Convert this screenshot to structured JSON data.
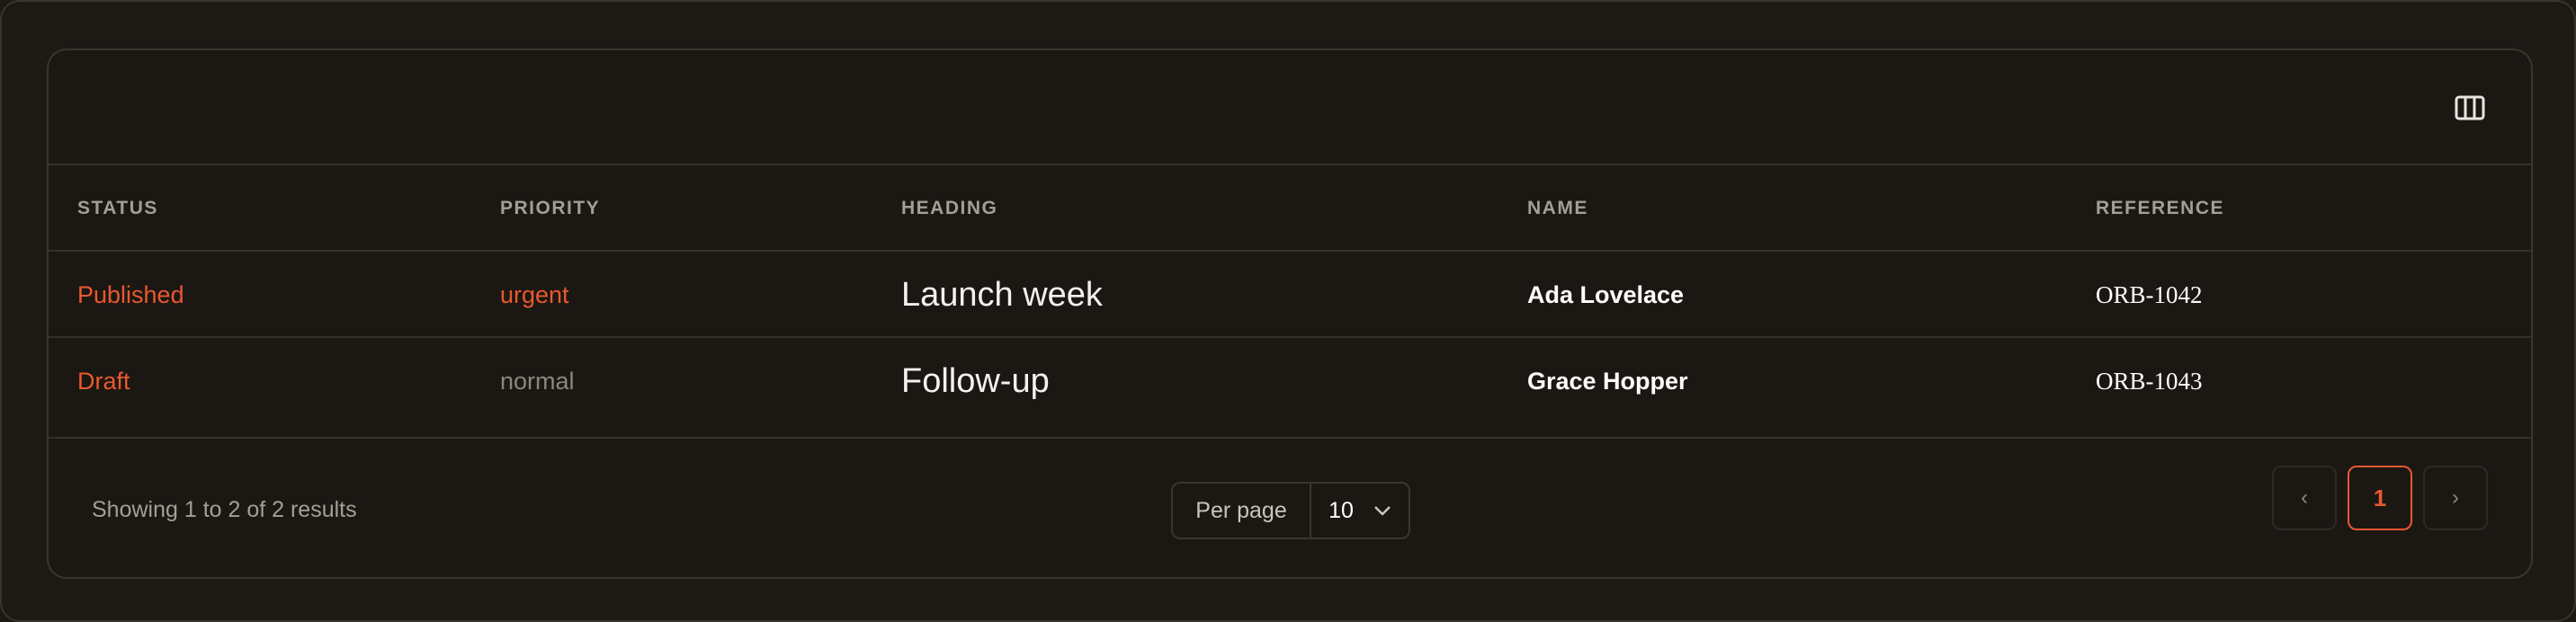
{
  "toolbar": {
    "columns_icon": "columns-icon"
  },
  "table": {
    "headers": {
      "status": "STATUS",
      "priority": "PRIORITY",
      "heading": "HEADING",
      "name": "NAME",
      "reference": "REFERENCE"
    },
    "rows": [
      {
        "status": "Published",
        "priority": "urgent",
        "heading": "Launch week",
        "name": "Ada Lovelace",
        "reference": "ORB-1042"
      },
      {
        "status": "Draft",
        "priority": "normal",
        "heading": "Follow-up",
        "name": "Grace Hopper",
        "reference": "ORB-1043"
      }
    ]
  },
  "footer": {
    "summary": "Showing 1 to 2 of 2 results",
    "per_page_label": "Per page",
    "per_page_value": "10",
    "prev_label": "‹",
    "current_page": "1",
    "next_label": "›"
  },
  "colors": {
    "accent": "#e9582e",
    "background": "#1b1713",
    "border": "#36312b",
    "muted": "#8c8680"
  }
}
